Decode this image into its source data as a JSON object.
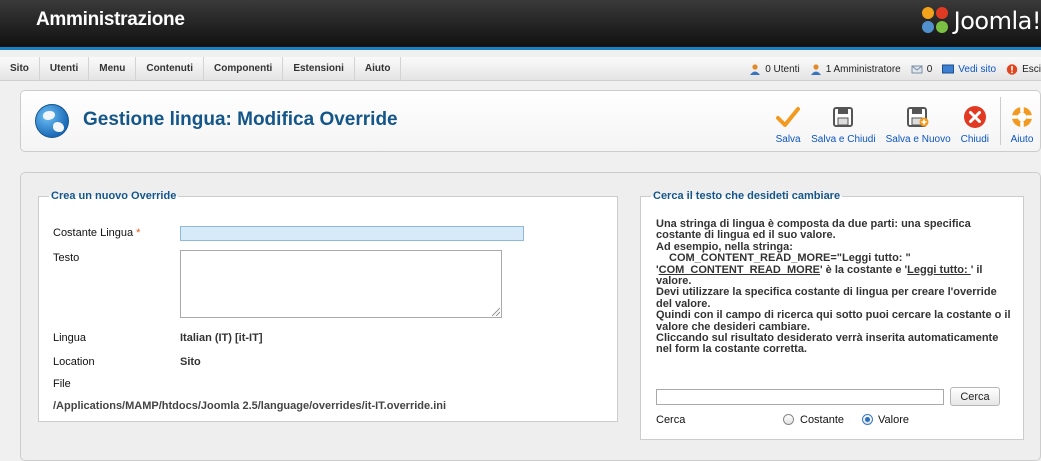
{
  "header": {
    "title": "Amministrazione",
    "logo_text": "Joomla!",
    "logo_icon": "joomla-logo-icon"
  },
  "menu": {
    "items": [
      "Sito",
      "Utenti",
      "Menu",
      "Contenuti",
      "Componenti",
      "Estensioni",
      "Aiuto"
    ]
  },
  "status": {
    "users": "0 Utenti",
    "admins": "1 Amministratore",
    "messages": "0",
    "view_site": "Vedi sito",
    "logout": "Esci"
  },
  "page": {
    "title": "Gestione lingua: Modifica Override",
    "icon": "globe-icon"
  },
  "toolbar": {
    "save": "Salva",
    "save_close": "Salva e Chiudi",
    "save_new": "Salva e Nuovo",
    "close": "Chiudi",
    "help": "Aiuto"
  },
  "colors": {
    "header_accent": "#1b7fc4",
    "title_blue": "#14568a",
    "link_blue": "#0b55c4",
    "required": "#e2591a",
    "close_red": "#e23a22",
    "save_orange": "#f19a1f"
  },
  "form": {
    "legend": "Crea un nuovo Override",
    "constant_label": "Costante Lingua",
    "required_mark": "*",
    "constant_value": "",
    "text_label": "Testo",
    "text_value": "",
    "language_label": "Lingua",
    "language_value": "Italian (IT) [it-IT]",
    "location_label": "Location",
    "location_value": "Sito",
    "file_label": "File",
    "file_value": "/Applications/MAMP/htdocs/Joomla 2.5/language/overrides/it-IT.override.ini"
  },
  "search": {
    "legend": "Cerca il testo che desideti cambiare",
    "help_1": "Una stringa di lingua è composta da due parti: una specifica costante di lingua ed il suo valore.",
    "help_2": "Ad esempio, nella stringa:",
    "help_3": "COM_CONTENT_READ_MORE=\"Leggi tutto: \"",
    "help_4a": "'",
    "help_4b": "COM_CONTENT_READ_MORE",
    "help_4c": "' è la costante e '",
    "help_4d": "Leggi tutto: ",
    "help_4e": "' il valore.",
    "help_5": "Devi utilizzare la specifica costante di lingua per creare l'override del valore.",
    "help_6": "Quindi con il campo di ricerca qui sotto puoi cercare la costante o il valore che desideri cambiare.",
    "help_7": "Cliccando sul risultato desiderato verrà inserita automaticamente nel form la costante corretta.",
    "input_value": "",
    "button": "Cerca",
    "type_label": "Cerca",
    "option_constant": "Costante",
    "option_value": "Valore",
    "selected": "Valore"
  }
}
